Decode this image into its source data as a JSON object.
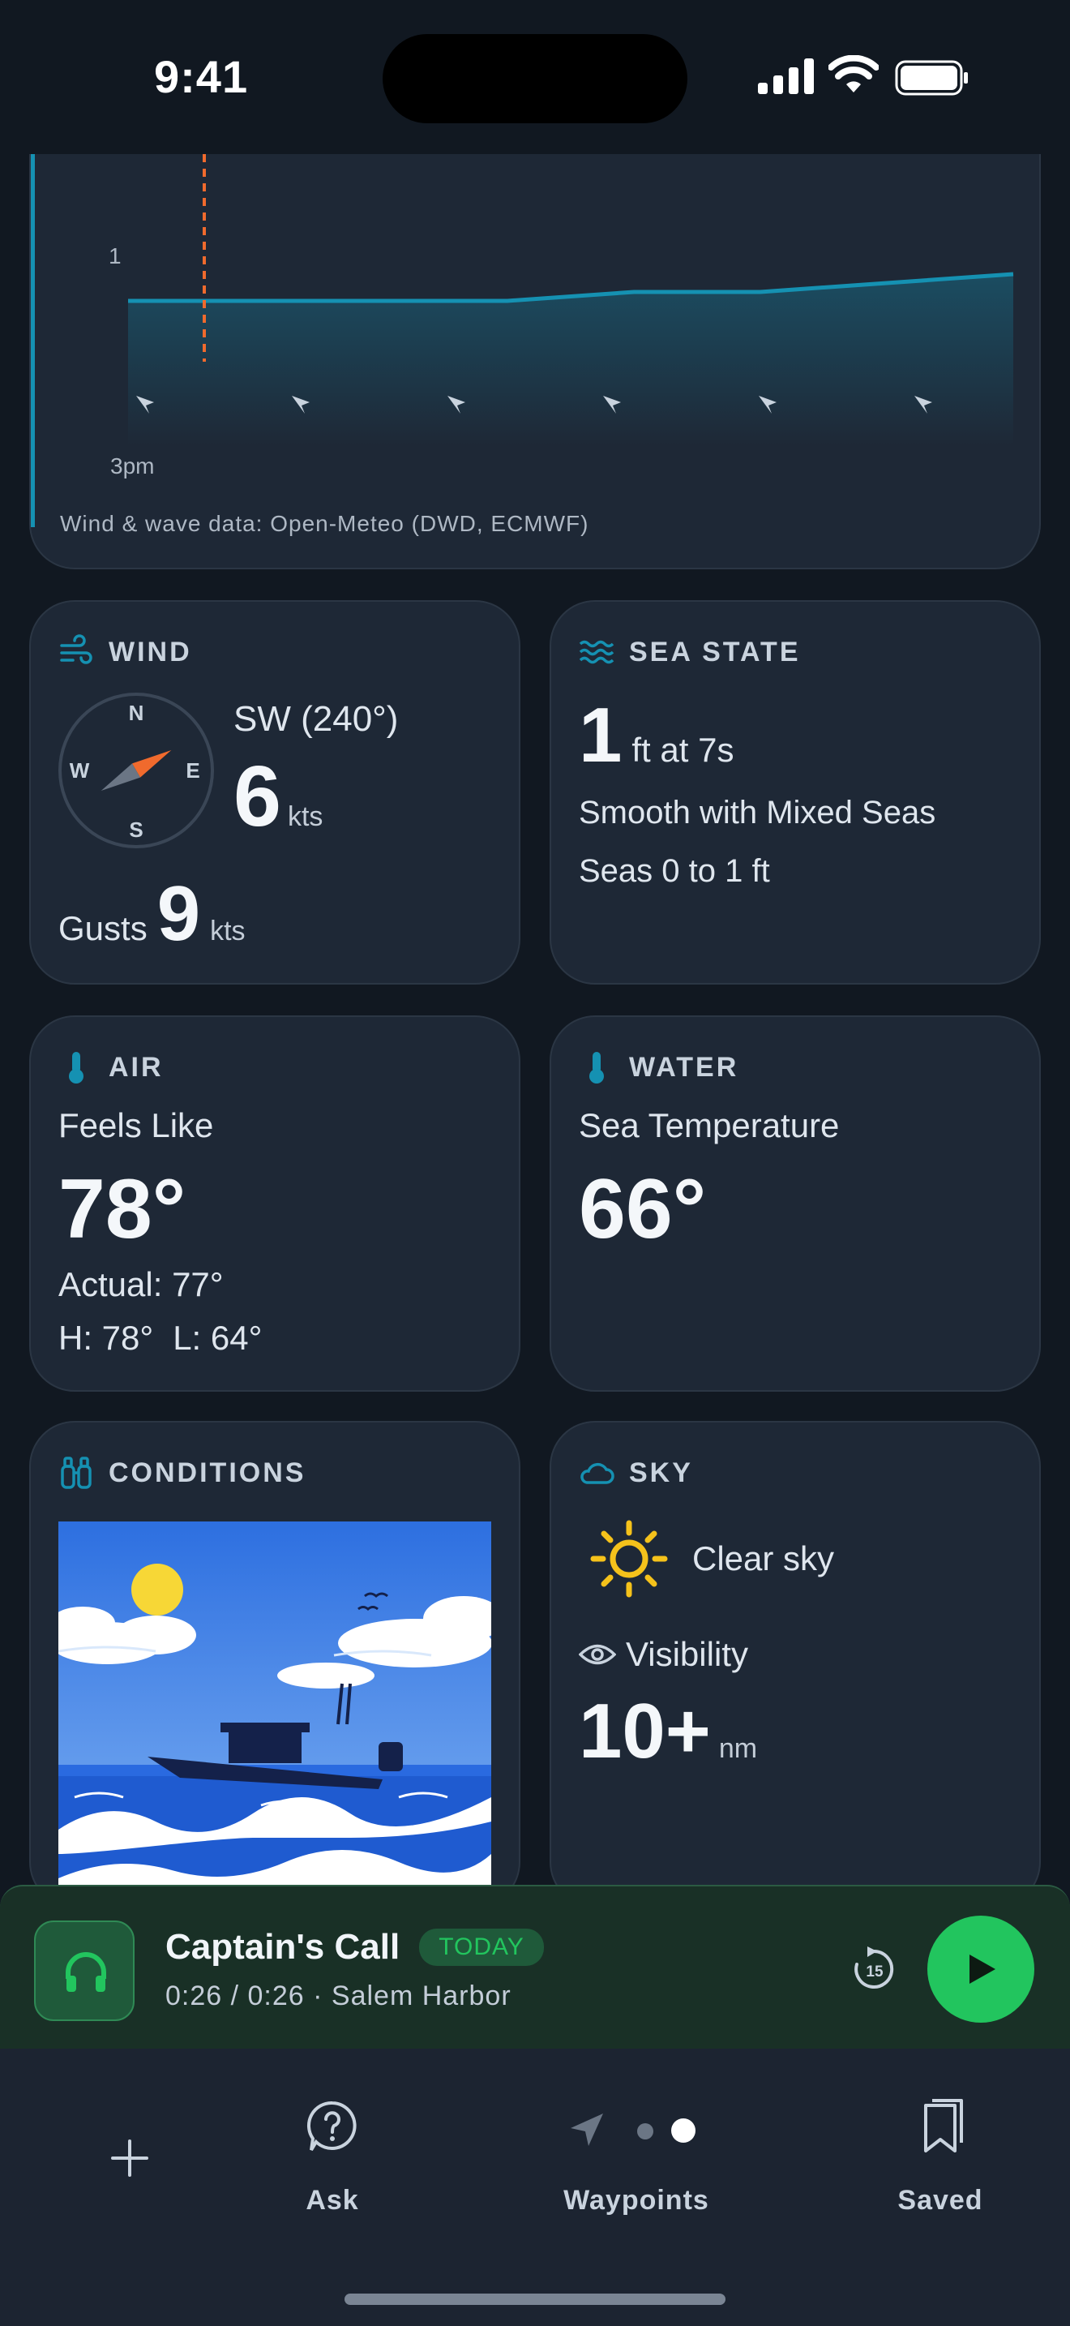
{
  "status": {
    "time": "9:41"
  },
  "chart": {
    "y_tick": "1",
    "x_tick": "3pm",
    "attribution": "Wind & wave data: Open-Meteo (DWD, ECMWF)"
  },
  "chart_data": {
    "type": "area",
    "x": [
      "3pm",
      "",
      "",
      "",
      "",
      "",
      "",
      ""
    ],
    "series": [
      {
        "values": [
          0.85,
          0.85,
          0.85,
          0.85,
          0.9,
          0.9,
          0.95,
          1.0
        ]
      }
    ],
    "y_ticks": [
      "1"
    ],
    "x_ticks": [
      "3pm"
    ],
    "marker": "current time (dashed orange line)",
    "arrow_direction": "SW",
    "colors": {
      "line": "#1591b2",
      "marker": "#f06a2d"
    }
  },
  "wind": {
    "title": "WIND",
    "compass": {
      "n": "N",
      "e": "E",
      "s": "S",
      "w": "W"
    },
    "direction": "SW (240°)",
    "speed": "6",
    "speed_unit": "kts",
    "gusts_label": "Gusts",
    "gusts": "9",
    "gusts_unit": "kts"
  },
  "sea": {
    "title": "SEA STATE",
    "height": "1",
    "height_rest": "ft at 7s",
    "desc": "Smooth with Mixed Seas",
    "range": "Seas 0 to 1 ft"
  },
  "air": {
    "title": "AIR",
    "feels_label": "Feels Like",
    "feels": "78°",
    "actual": "Actual: 77°",
    "high": "H: 78°",
    "low": "L: 64°"
  },
  "water": {
    "title": "WATER",
    "label": "Sea Temperature",
    "temp": "66°"
  },
  "conditions": {
    "title": "CONDITIONS"
  },
  "sky": {
    "title": "SKY",
    "desc": "Clear sky",
    "visibility_label": "Visibility",
    "visibility": "10+",
    "visibility_unit": "nm"
  },
  "now_playing": {
    "title": "Captain's Call",
    "badge": "TODAY",
    "subtitle": "0:26 / 0:26 · Salem Harbor",
    "skip_seconds": "15"
  },
  "tabs": [
    {
      "label": ""
    },
    {
      "label": "Ask"
    },
    {
      "label": "Waypoints"
    },
    {
      "label": "Saved"
    }
  ],
  "colors": {
    "accent": "#1591b2",
    "green": "#22c55e",
    "orange": "#f06a2d",
    "sun": "#f5c21b"
  }
}
